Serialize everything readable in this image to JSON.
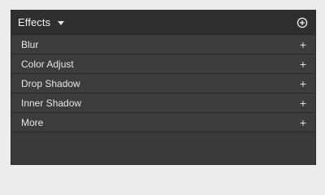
{
  "panel": {
    "title": "Effects",
    "header_icons": {
      "dropdown": "chevron-down-icon",
      "add": "plus-circle-icon"
    }
  },
  "effects": [
    {
      "label": "Blur",
      "action": "+"
    },
    {
      "label": "Color Adjust",
      "action": "+"
    },
    {
      "label": "Drop Shadow",
      "action": "+"
    },
    {
      "label": "Inner Shadow",
      "action": "+"
    },
    {
      "label": "More",
      "action": "+"
    }
  ],
  "colors": {
    "panel_bg": "#3a3a3a",
    "header_bg": "#2f2f2f",
    "text": "#e6e6e6",
    "page_bg": "#ececec"
  }
}
